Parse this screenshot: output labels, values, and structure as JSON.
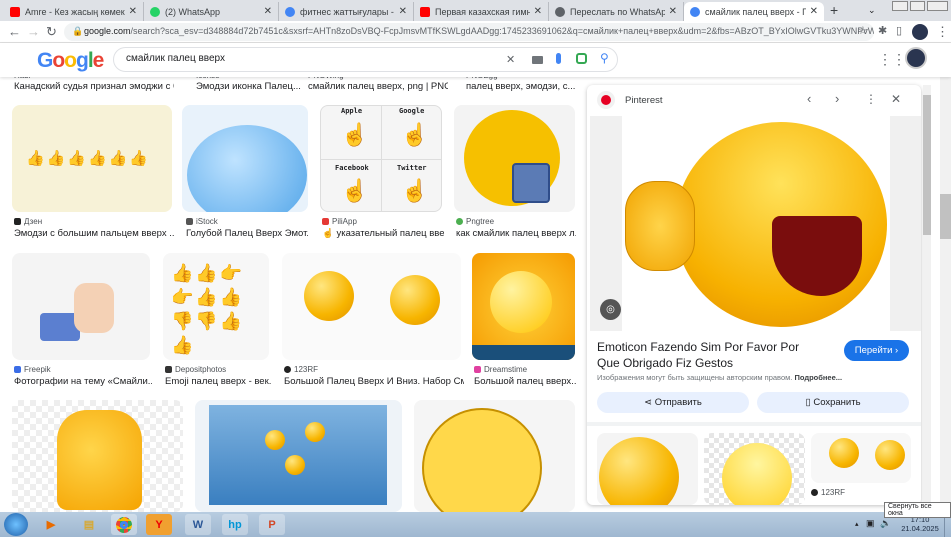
{
  "tabs": [
    {
      "title": "Amre - Кез жасың көмектеспе",
      "color": "#ff0000"
    },
    {
      "title": "(2) WhatsApp",
      "color": "#25d366"
    },
    {
      "title": "фитнес жаттығулары - Поиск",
      "color": "#4285f4"
    },
    {
      "title": "Первая казахская гимнастика",
      "color": "#ff0000"
    },
    {
      "title": "Переслать по WhatsApp",
      "color": "#5f6368"
    },
    {
      "title": "смайлик палец вверх - Поиск",
      "color": "#4285f4"
    }
  ],
  "address": {
    "domain": "google.com",
    "path": "/search?sca_esv=d348884d72b7451c&sxsrf=AHTn8zoDsVBQ-FcpJmsvMTfKSWLgdAADgg:1745233691062&q=смайлик+палец+вверх&udm=2&fbs=ABzOT_BYxIOlwGVTku3YWNPvW5AUx..."
  },
  "google": {
    "logo": "Google",
    "query": "смайлик палец вверх"
  },
  "results_top": [
    {
      "source": "Habr",
      "caption": "Канадский судья признал эмоджи с бо..."
    },
    {
      "source": "Icons8",
      "caption": "Эмодзи иконка Палец..."
    },
    {
      "source": "PNGWing",
      "caption": "смайлик палец вверх, png | PNG..."
    },
    {
      "source": "PNGEgg",
      "caption": "палец вверх, эмодзи, с..."
    }
  ],
  "results_row1": [
    {
      "source": "Дзен",
      "caption": "Эмодзи с большим пальцем вверх ..."
    },
    {
      "source": "iStock",
      "caption": "Голубой Палец Вверх Эмот..."
    },
    {
      "source": "PiliApp",
      "caption": "☝ указательный палец вверх",
      "labels": [
        "Apple",
        "Google",
        "Facebook",
        "Twitter"
      ]
    },
    {
      "source": "Pngtree",
      "caption": "как смайлик палец вверх л..."
    }
  ],
  "results_row2": [
    {
      "source": "Freepik",
      "caption": "Фотографии на тему «Смайли..."
    },
    {
      "source": "Depositphotos",
      "caption": "Emoji палец вверх - век..."
    },
    {
      "source": "123RF",
      "caption": "Большой Палец Вверх И Вниз. Набор См..."
    },
    {
      "source": "Dreamstime",
      "caption": "Большой палец вверх..."
    }
  ],
  "panel": {
    "source": "Pinterest",
    "title": "Emoticon Fazendo Sim Por Favor Por Que Obrigado Fiz Gestos",
    "visit": "Перейти",
    "copyright": "Изображения могут быть защищены авторским правом.",
    "more": "Подробнее...",
    "share": "Отправить",
    "save": "Сохранить",
    "related_source": "123RF"
  },
  "taskbar": {
    "time": "17:10",
    "date": "21.04.2025",
    "tooltip": "Свернуть все окна"
  }
}
